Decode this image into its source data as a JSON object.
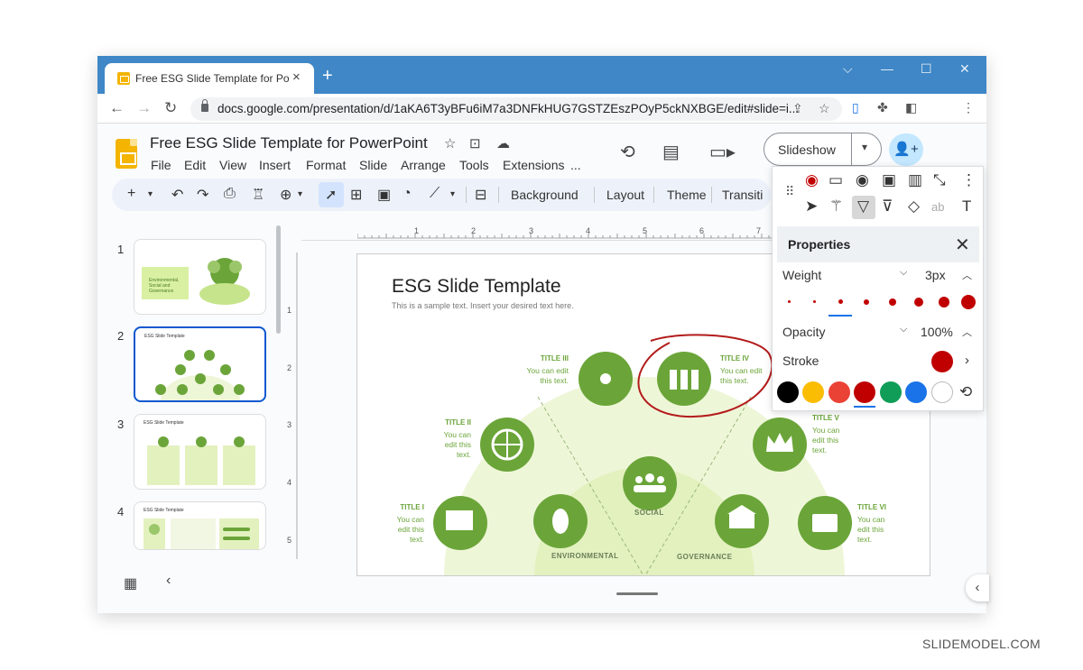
{
  "browser": {
    "tab_title": "Free ESG Slide Template for Pow",
    "tab_close": "×",
    "new_tab": "+",
    "window_controls": [
      "⌵",
      "—",
      "☐",
      "✕"
    ],
    "url": "docs.google.com/presentation/d/1aKA6T3yBFu6iM7a3DNFkHUG7GSTZEszPOyP5ckNXBGE/edit#slide=i..."
  },
  "app": {
    "doc_title": "Free ESG Slide Template for PowerPoint",
    "menus": [
      "File",
      "Edit",
      "View",
      "Insert",
      "Format",
      "Slide",
      "Arrange",
      "Tools",
      "Extensions",
      "..."
    ],
    "slideshow_label": "Slideshow",
    "toolbar": {
      "background": "Background",
      "layout": "Layout",
      "theme": "Theme",
      "transition": "Transiti"
    }
  },
  "sidebar": {
    "slides": [
      {
        "num": "1",
        "title": "Environmental, Social and Governance"
      },
      {
        "num": "2",
        "title": "ESG Slide Template"
      },
      {
        "num": "3",
        "title": "ESG Slide Template"
      },
      {
        "num": "4",
        "title": "ESG Slide Template"
      }
    ]
  },
  "ruler": {
    "h": [
      "1",
      "2",
      "3",
      "4",
      "5",
      "6",
      "7"
    ],
    "v": [
      "1",
      "2",
      "3",
      "4",
      "5"
    ]
  },
  "slide": {
    "title": "ESG Slide Template",
    "subtitle": "This is a sample text. Insert your desired text here.",
    "items": [
      {
        "title": "TITLE I",
        "text": "You can edit this text."
      },
      {
        "title": "TITLE II",
        "text": "You can edit this text."
      },
      {
        "title": "TITLE III",
        "text": "You can edit this text."
      },
      {
        "title": "TITLE IV",
        "text": "You can edit this text."
      },
      {
        "title": "TITLE V",
        "text": "You can edit this text."
      },
      {
        "title": "TITLE VI",
        "text": "You can edit this text."
      }
    ],
    "categories": {
      "environmental": "ENVIRONMENTAL",
      "social": "SOCIAL",
      "governance": "GOVERNANCE"
    }
  },
  "panel": {
    "title": "Properties",
    "weight_label": "Weight",
    "weight_value": "3px",
    "opacity_label": "Opacity",
    "opacity_value": "100%",
    "stroke_label": "Stroke",
    "swatches": [
      "#000000",
      "#fbbc04",
      "#ea4335",
      "#c00000",
      "#0f9d58",
      "#1a73e8",
      "#ffffff"
    ]
  },
  "colors": {
    "accent_green": "#6ba539",
    "ink_red": "#c00000"
  },
  "watermark": "SLIDEMODEL.COM"
}
